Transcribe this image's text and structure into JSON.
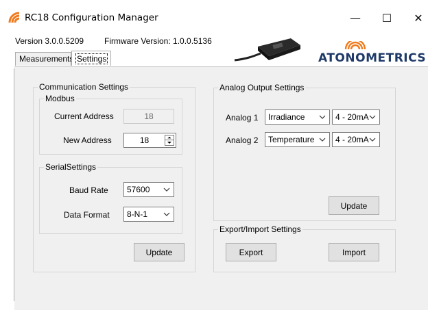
{
  "window": {
    "title": "RC18 Configuration Manager",
    "minimize": "—",
    "maximize": "☐",
    "close": "✕"
  },
  "header": {
    "version": "Version 3.0.0.5209",
    "firmware": "Firmware Version: 1.0.0.5136",
    "brand": "ATONOMETRICS"
  },
  "tabs": [
    {
      "label": "Measurements",
      "active": false
    },
    {
      "label": "Settings",
      "active": true
    }
  ],
  "communication": {
    "legend": "Communication Settings",
    "modbus": {
      "legend": "Modbus",
      "current_address_label": "Current Address",
      "current_address_value": "18",
      "new_address_label": "New Address",
      "new_address_value": "18"
    },
    "serial": {
      "legend": "SerialSettings",
      "baud_rate_label": "Baud Rate",
      "baud_rate_value": "57600",
      "data_format_label": "Data Format",
      "data_format_value": "8-N-1"
    },
    "update_label": "Update"
  },
  "analog": {
    "legend": "Analog Output Settings",
    "outputs": [
      {
        "label": "Analog 1",
        "measure": "Irradiance",
        "range": "4 - 20mA"
      },
      {
        "label": "Analog 2",
        "measure": "Temperature",
        "range": "4 - 20mA"
      }
    ],
    "update_label": "Update"
  },
  "export_import": {
    "legend": "Export/Import Settings",
    "export_label": "Export",
    "import_label": "Import"
  },
  "colors": {
    "brand_navy": "#1f3a68",
    "brand_orange": "#f07a1c",
    "button_face": "#e1e1e1",
    "panel_bg": "#f0f0f0"
  }
}
